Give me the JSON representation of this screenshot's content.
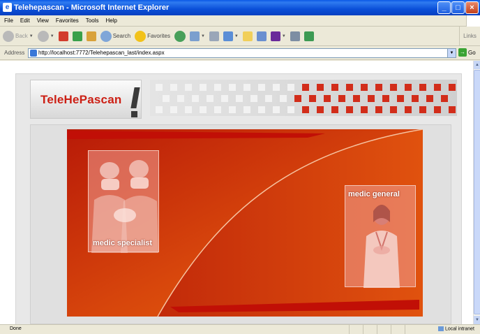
{
  "window": {
    "title": "Telehepascan - Microsoft Internet Explorer"
  },
  "menu": [
    "File",
    "Edit",
    "View",
    "Favorites",
    "Tools",
    "Help"
  ],
  "toolbar": {
    "back": "Back",
    "search": "Search",
    "favorites": "Favorites",
    "links": "Links"
  },
  "address": {
    "label": "Address",
    "url": "http://localhost:7772/Telehepascan_last/index.aspx",
    "go": "Go"
  },
  "page": {
    "logo_text": "TeleHePascan",
    "cards": {
      "specialist": "medic specialist",
      "general": "medic general"
    }
  },
  "status": {
    "text": "Done",
    "zone": "Local intranet"
  },
  "colors": {
    "accent": "#cc1f14",
    "hero": "#c02a0c",
    "titlebar": "#0a58e6"
  },
  "icons": [
    "back-icon",
    "forward-icon",
    "stop-icon",
    "refresh-icon",
    "home-icon",
    "search-icon",
    "favorites-icon",
    "history-icon",
    "mail-icon",
    "print-icon",
    "edit-icon",
    "folder-icon",
    "messenger-icon",
    "yahoo-icon",
    "research-icon",
    "msn-icon",
    "go-icon",
    "ie-page-icon",
    "intranet-icon"
  ]
}
